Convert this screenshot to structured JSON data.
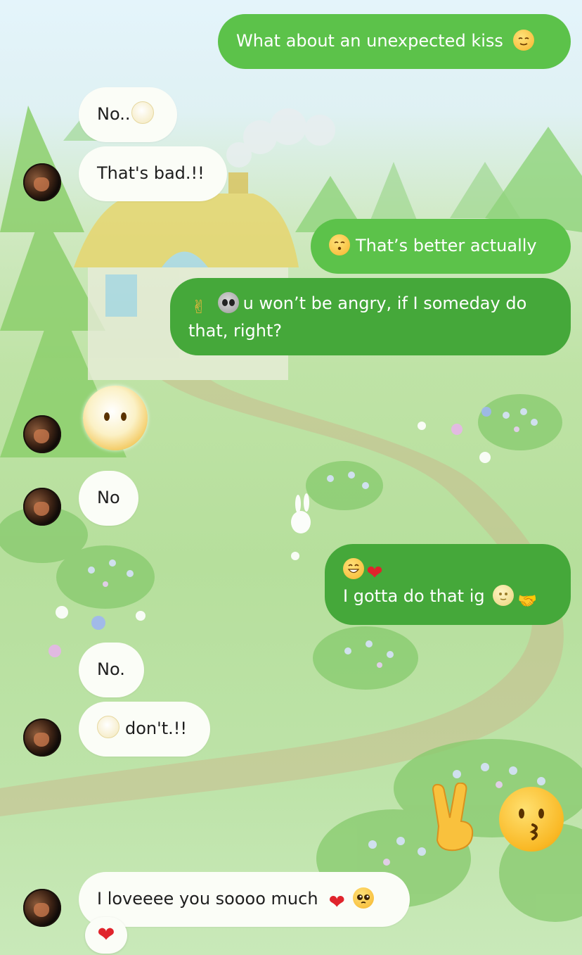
{
  "messages": {
    "m1": "What about an unexpected kiss",
    "m2": "No..",
    "m3": "That's bad.!!",
    "m4": "That’s better actually",
    "m5_line1": "u won’t be angry, if I someday do",
    "m5_line2": "that, right?",
    "m6": "No",
    "m7": "I gotta do that ig",
    "m8": "No.",
    "m9": "don't.!!",
    "m10": "I loveeee you soooo much"
  },
  "emoji": {
    "relieved": "relieved-face",
    "fog_face": "face-in-clouds",
    "kissing_closed": "kissing-face-closed-eyes",
    "victory": "victory-hand",
    "alien": "alien",
    "grin": "beaming-face",
    "heart": "red-heart",
    "moon": "full-moon-face",
    "handshake": "handshake",
    "kissing": "kissing-face",
    "pleading": "pleading-face"
  },
  "glyphs": {
    "heart": "❤",
    "victory": "✌",
    "handshake": "🤝",
    "reaction_heart": "❤"
  },
  "colors": {
    "bubble_out_light": "#5cc24a",
    "bubble_out_dark": "#45a83a",
    "bubble_in": "#fbfdf7",
    "heart": "#e0242c"
  }
}
